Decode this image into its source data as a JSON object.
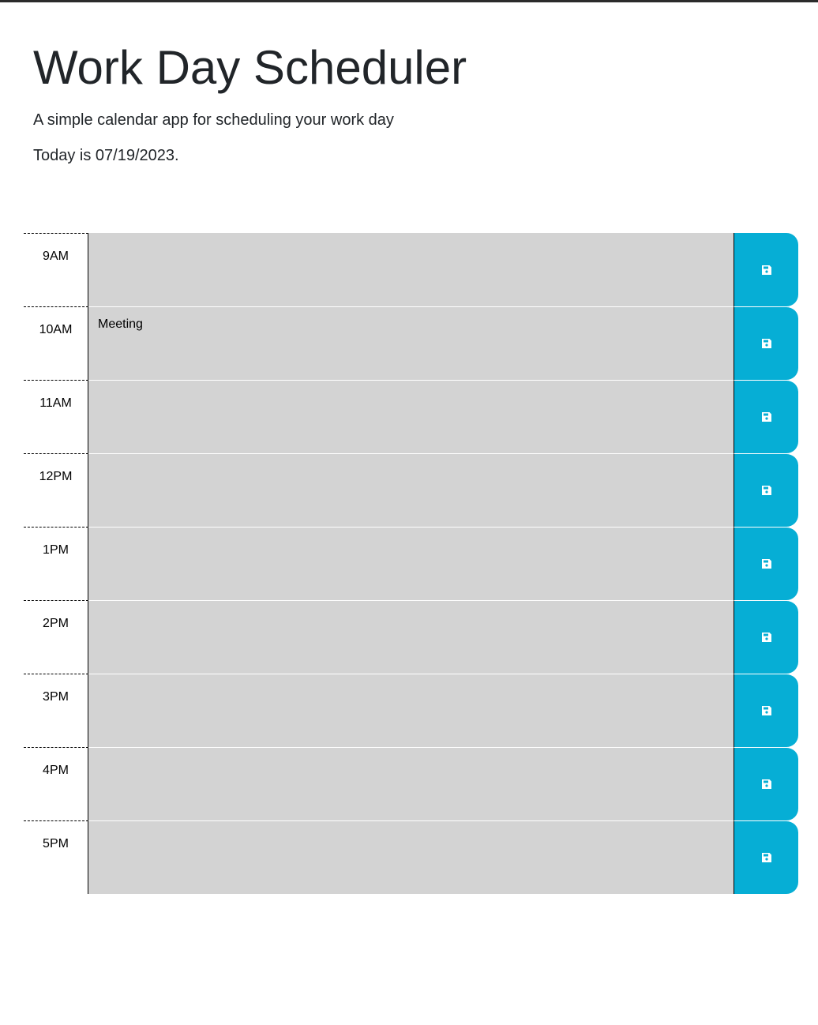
{
  "header": {
    "title": "Work Day Scheduler",
    "subtitle": "A simple calendar app for scheduling your work day",
    "today": "Today is 07/19/2023."
  },
  "colors": {
    "block": "#d3d3d3",
    "save_button": "#06aed5"
  },
  "save_icon": "floppy-disk-icon",
  "rows": [
    {
      "hour": "9AM",
      "text": ""
    },
    {
      "hour": "10AM",
      "text": "Meeting"
    },
    {
      "hour": "11AM",
      "text": ""
    },
    {
      "hour": "12PM",
      "text": ""
    },
    {
      "hour": "1PM",
      "text": ""
    },
    {
      "hour": "2PM",
      "text": ""
    },
    {
      "hour": "3PM",
      "text": ""
    },
    {
      "hour": "4PM",
      "text": ""
    },
    {
      "hour": "5PM",
      "text": ""
    }
  ]
}
